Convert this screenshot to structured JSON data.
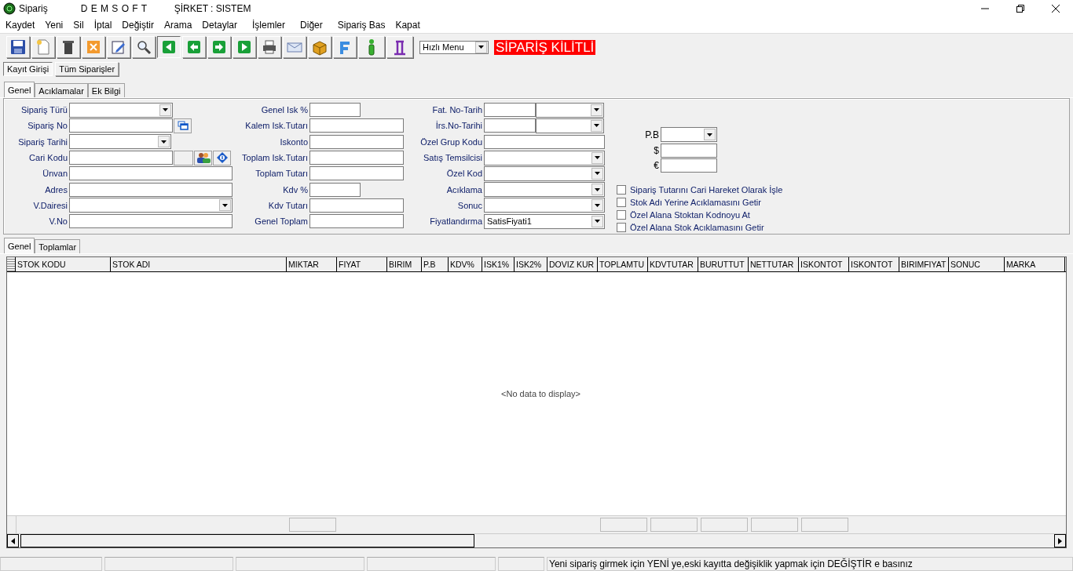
{
  "window": {
    "title": "Sipariş",
    "brand": "D E M S O F T",
    "company": "ŞİRKET : SISTEM"
  },
  "menu": [
    "Kaydet",
    "Yeni",
    "Sil",
    "İptal",
    "Değiştir",
    "Arama",
    "Detaylar",
    "İşlemler",
    "Diğer",
    "Sipariş Bas",
    "Kapat"
  ],
  "quick_menu": {
    "value": "Hızlı Menu"
  },
  "lock_label": "SİPARİŞ KİLİTLİ",
  "view_tabs": [
    {
      "label": "Kayıt Girişi",
      "selected": true
    },
    {
      "label": "Tüm Siparişler",
      "selected": false
    }
  ],
  "form_tabs": [
    {
      "label": "Genel",
      "selected": true
    },
    {
      "label": "Acıklamalar",
      "selected": false
    },
    {
      "label": "Ek Bilgi",
      "selected": false
    }
  ],
  "form": {
    "column_1": [
      {
        "label": "Sipariş Türü",
        "kind": "combo"
      },
      {
        "label": "Sipariş No",
        "kind": "browse"
      },
      {
        "label": "Sipariş Tarihi",
        "kind": "date"
      },
      {
        "label": "Cari Kodu",
        "kind": "lookup"
      },
      {
        "label": "Ünvan",
        "kind": "wide"
      },
      {
        "label": "Adres",
        "kind": "wide"
      },
      {
        "label": "V.Dairesi",
        "kind": "widecombo"
      },
      {
        "label": "V.No",
        "kind": "wide"
      }
    ],
    "column_2": [
      {
        "label": "Genel Isk %",
        "kind": "short"
      },
      {
        "label": "Kalem Isk.Tutarı",
        "kind": "text"
      },
      {
        "label": "Iskonto",
        "kind": "text"
      },
      {
        "label": "Toplam Isk.Tutarı",
        "kind": "text"
      },
      {
        "label": "Toplam Tutarı",
        "kind": "text"
      },
      {
        "label": "Kdv %",
        "kind": "short"
      },
      {
        "label": "Kdv Tutarı",
        "kind": "text"
      },
      {
        "label": "Genel Toplam",
        "kind": "text"
      }
    ],
    "column_3": [
      {
        "label": "Fat. No-Tarih",
        "kind": "pair"
      },
      {
        "label": "İrs.No-Tarihi",
        "kind": "pair"
      },
      {
        "label": "Özel Grup Kodu",
        "kind": "long"
      },
      {
        "label": "Satış Temsilcisi",
        "kind": "longcombo"
      },
      {
        "label": "Özel Kod",
        "kind": "longcombo"
      },
      {
        "label": "Acıklama",
        "kind": "longcombo"
      },
      {
        "label": "Sonuc",
        "kind": "longcombo"
      },
      {
        "label": "Fiyatlandırma",
        "kind": "longcombo",
        "value": "SatisFiyati1"
      }
    ],
    "currency": [
      {
        "label": "P.B",
        "kind": "combo"
      },
      {
        "label": "$",
        "kind": "text"
      },
      {
        "label": "€",
        "kind": "text"
      }
    ],
    "options": [
      {
        "label": "Sipariş Tutarını Cari Hareket Olarak İşle",
        "checked": false
      },
      {
        "label": "Stok Adı Yerine Acıklamasını Getir",
        "checked": false
      },
      {
        "label": "Özel Alana Stoktan Kodnoyu At",
        "checked": false
      },
      {
        "label": "Özel Alana Stok Acıklamasını Getir",
        "checked": false
      }
    ]
  },
  "grid_tabs": [
    {
      "label": "Genel",
      "selected": true
    },
    {
      "label": "Toplamlar",
      "selected": false
    }
  ],
  "grid": {
    "columns": [
      {
        "title": "STOK KODU",
        "summary": false
      },
      {
        "title": "STOK ADI",
        "summary": false
      },
      {
        "title": "MIKTAR",
        "summary": true
      },
      {
        "title": "FIYAT",
        "summary": false
      },
      {
        "title": "BIRIM",
        "summary": false
      },
      {
        "title": "P.B",
        "summary": false
      },
      {
        "title": "KDV%",
        "summary": false
      },
      {
        "title": "ISK1%",
        "summary": false
      },
      {
        "title": "ISK2%",
        "summary": false
      },
      {
        "title": "DOVIZ KUR",
        "summary": false
      },
      {
        "title": "TOPLAMTU",
        "summary": true
      },
      {
        "title": "KDVTUTAR",
        "summary": true
      },
      {
        "title": "BURUTTUT",
        "summary": true
      },
      {
        "title": "NETTUTAR",
        "summary": true
      },
      {
        "title": "ISKONTOT",
        "summary": true
      },
      {
        "title": "ISKONTOT",
        "summary": false
      },
      {
        "title": "BIRIMFIYAT",
        "summary": false
      },
      {
        "title": "SONUC",
        "summary": false
      },
      {
        "title": "MARKA",
        "summary": false
      }
    ],
    "empty_text": "<No data to display>"
  },
  "status_bar": {
    "message": "Yeni sipariş girmek için YENİ ye,eski kayıtta değişiklik yapmak için DEĞİŞTİR e basınız"
  }
}
